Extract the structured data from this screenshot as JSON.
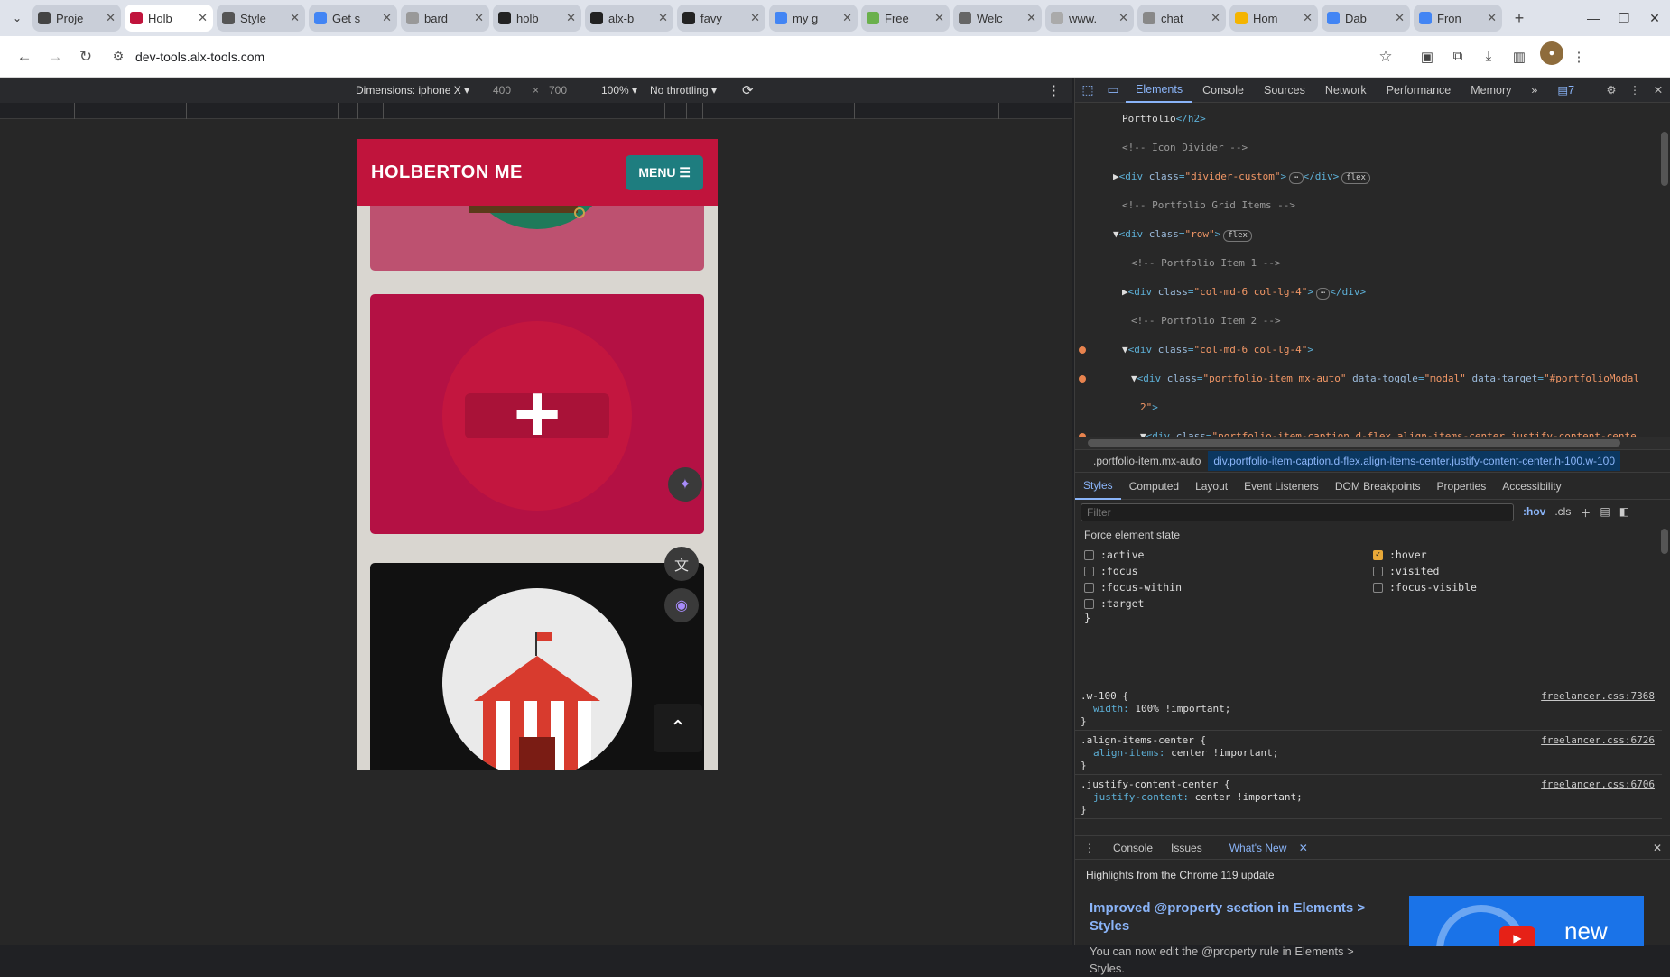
{
  "browser": {
    "tabs": [
      {
        "title": "Proje",
        "favicon": "alx",
        "color": "#444"
      },
      {
        "title": "Holb",
        "favicon": "H",
        "color": "#c0143c",
        "active": true
      },
      {
        "title": "Style",
        "favicon": "book",
        "color": "#555"
      },
      {
        "title": "Get s",
        "favicon": "G",
        "color": "#4285f4"
      },
      {
        "title": "bard",
        "favicon": "b",
        "color": "#999"
      },
      {
        "title": "holb",
        "favicon": "gh",
        "color": "#222"
      },
      {
        "title": "alx-b",
        "favicon": "gh",
        "color": "#222"
      },
      {
        "title": "favy",
        "favicon": "gh",
        "color": "#222"
      },
      {
        "title": "my g",
        "favicon": "doc",
        "color": "#4285f4"
      },
      {
        "title": "Free",
        "favicon": "fr",
        "color": "#6ab04c"
      },
      {
        "title": "Welc",
        "favicon": "w",
        "color": "#666"
      },
      {
        "title": "www.",
        "favicon": "w",
        "color": "#aaa"
      },
      {
        "title": "chat",
        "favicon": "c",
        "color": "#888"
      },
      {
        "title": "Hom",
        "favicon": "d",
        "color": "#f4b400"
      },
      {
        "title": "Dab",
        "favicon": "doc",
        "color": "#4285f4"
      },
      {
        "title": "Fron",
        "favicon": "doc",
        "color": "#4285f4"
      }
    ],
    "url": "dev-tools.alx-tools.com"
  },
  "device_toolbar": {
    "dimensions": "Dimensions: iphone X",
    "width": "400",
    "times": "×",
    "height": "700",
    "zoom": "100%",
    "throttling": "No throttling"
  },
  "page": {
    "brand": "HOLBERTON ME",
    "menu_label": "MENU"
  },
  "devtools": {
    "tabs": [
      "Elements",
      "Console",
      "Sources",
      "Network",
      "Performance",
      "Memory"
    ],
    "issues_count": "7",
    "breadcrumbs": [
      ".portfolio-item.mx-auto",
      "div.portfolio-item-caption.d-flex.align-items-center.justify-content-center.h-100.w-100"
    ],
    "subtabs": [
      "Styles",
      "Computed",
      "Layout",
      "Event Listeners",
      "DOM Breakpoints",
      "Properties",
      "Accessibility"
    ],
    "filter_placeholder": "Filter",
    "hov": ":hov",
    "cls": ".cls",
    "force_title": "Force element state",
    "states": [
      {
        "label": ":active",
        "checked": false
      },
      {
        "label": ":hover",
        "checked": true
      },
      {
        "label": ":focus",
        "checked": false
      },
      {
        "label": ":visited",
        "checked": false
      },
      {
        "label": ":focus-within",
        "checked": false
      },
      {
        "label": ":focus-visible",
        "checked": false
      },
      {
        "label": ":target",
        "checked": false
      }
    ],
    "rules": [
      {
        "selector": ".w-100 {",
        "prop": "width",
        "value": "100% !important;",
        "source": "freelancer.css:7368"
      },
      {
        "selector": ".align-items-center {",
        "prop": "align-items",
        "value": "center !important;",
        "source": "freelancer.css:6726"
      },
      {
        "selector": ".justify-content-center {",
        "prop": "justify-content",
        "value": "center !important;",
        "source": "freelancer.css:6706"
      }
    ],
    "drawer": {
      "tabs": [
        "Console",
        "Issues",
        "What's New"
      ],
      "highlight": "Highlights from the Chrome 119 update",
      "feature_title": "Improved @property section in Elements > Styles",
      "feature_desc": "You can now edit the @property rule in Elements > Styles.",
      "promo_label": "new"
    }
  }
}
